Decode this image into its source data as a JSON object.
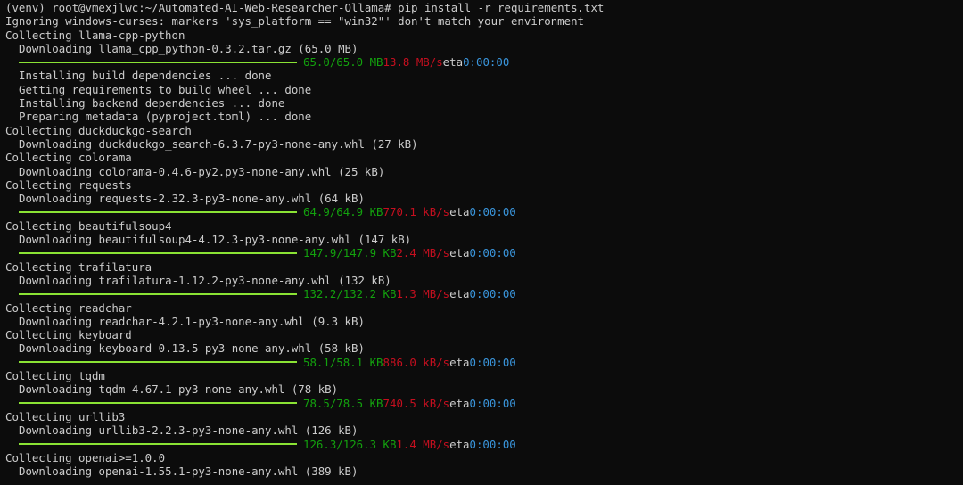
{
  "terminal": {
    "colors": {
      "background": "#0c0c0c",
      "foreground": "#cccccc",
      "bar": "#8ae234",
      "size": "#13a10e",
      "speed": "#c50f1f",
      "eta": "#3a96dd"
    },
    "lines": [
      {
        "type": "text",
        "text": "(venv) root@vmexjlwc:~/Automated-AI-Web-Researcher-Ollama# pip install -r requirements.txt"
      },
      {
        "type": "text",
        "text": "Ignoring windows-curses: markers 'sys_platform == \"win32\"' don't match your environment"
      },
      {
        "type": "text",
        "text": "Collecting llama-cpp-python"
      },
      {
        "type": "indent",
        "text": "Downloading llama_cpp_python-0.3.2.tar.gz (65.0 MB)"
      },
      {
        "type": "progress",
        "size": "65.0/65.0 MB",
        "speed": "13.8 MB/s",
        "eta_label": "eta",
        "eta": "0:00:00"
      },
      {
        "type": "indent",
        "text": "Installing build dependencies ... done"
      },
      {
        "type": "indent",
        "text": "Getting requirements to build wheel ... done"
      },
      {
        "type": "indent",
        "text": "Installing backend dependencies ... done"
      },
      {
        "type": "indent",
        "text": "Preparing metadata (pyproject.toml) ... done"
      },
      {
        "type": "text",
        "text": "Collecting duckduckgo-search"
      },
      {
        "type": "indent",
        "text": "Downloading duckduckgo_search-6.3.7-py3-none-any.whl (27 kB)"
      },
      {
        "type": "text",
        "text": "Collecting colorama"
      },
      {
        "type": "indent",
        "text": "Downloading colorama-0.4.6-py2.py3-none-any.whl (25 kB)"
      },
      {
        "type": "text",
        "text": "Collecting requests"
      },
      {
        "type": "indent",
        "text": "Downloading requests-2.32.3-py3-none-any.whl (64 kB)"
      },
      {
        "type": "progress",
        "size": "64.9/64.9 KB",
        "speed": "770.1 kB/s",
        "eta_label": "eta",
        "eta": "0:00:00"
      },
      {
        "type": "text",
        "text": "Collecting beautifulsoup4"
      },
      {
        "type": "indent",
        "text": "Downloading beautifulsoup4-4.12.3-py3-none-any.whl (147 kB)"
      },
      {
        "type": "progress",
        "size": "147.9/147.9 KB",
        "speed": "2.4 MB/s",
        "eta_label": "eta",
        "eta": "0:00:00"
      },
      {
        "type": "text",
        "text": "Collecting trafilatura"
      },
      {
        "type": "indent",
        "text": "Downloading trafilatura-1.12.2-py3-none-any.whl (132 kB)"
      },
      {
        "type": "progress",
        "size": "132.2/132.2 KB",
        "speed": "1.3 MB/s",
        "eta_label": "eta",
        "eta": "0:00:00"
      },
      {
        "type": "text",
        "text": "Collecting readchar"
      },
      {
        "type": "indent",
        "text": "Downloading readchar-4.2.1-py3-none-any.whl (9.3 kB)"
      },
      {
        "type": "text",
        "text": "Collecting keyboard"
      },
      {
        "type": "indent",
        "text": "Downloading keyboard-0.13.5-py3-none-any.whl (58 kB)"
      },
      {
        "type": "progress",
        "size": "58.1/58.1 KB",
        "speed": "886.0 kB/s",
        "eta_label": "eta",
        "eta": "0:00:00"
      },
      {
        "type": "text",
        "text": "Collecting tqdm"
      },
      {
        "type": "indent",
        "text": "Downloading tqdm-4.67.1-py3-none-any.whl (78 kB)"
      },
      {
        "type": "progress",
        "size": "78.5/78.5 KB",
        "speed": "740.5 kB/s",
        "eta_label": "eta",
        "eta": "0:00:00"
      },
      {
        "type": "text",
        "text": "Collecting urllib3"
      },
      {
        "type": "indent",
        "text": "Downloading urllib3-2.2.3-py3-none-any.whl (126 kB)"
      },
      {
        "type": "progress",
        "size": "126.3/126.3 KB",
        "speed": "1.4 MB/s",
        "eta_label": "eta",
        "eta": "0:00:00"
      },
      {
        "type": "text",
        "text": "Collecting openai>=1.0.0"
      },
      {
        "type": "indent",
        "text": "Downloading openai-1.55.1-py3-none-any.whl (389 kB)"
      }
    ]
  }
}
